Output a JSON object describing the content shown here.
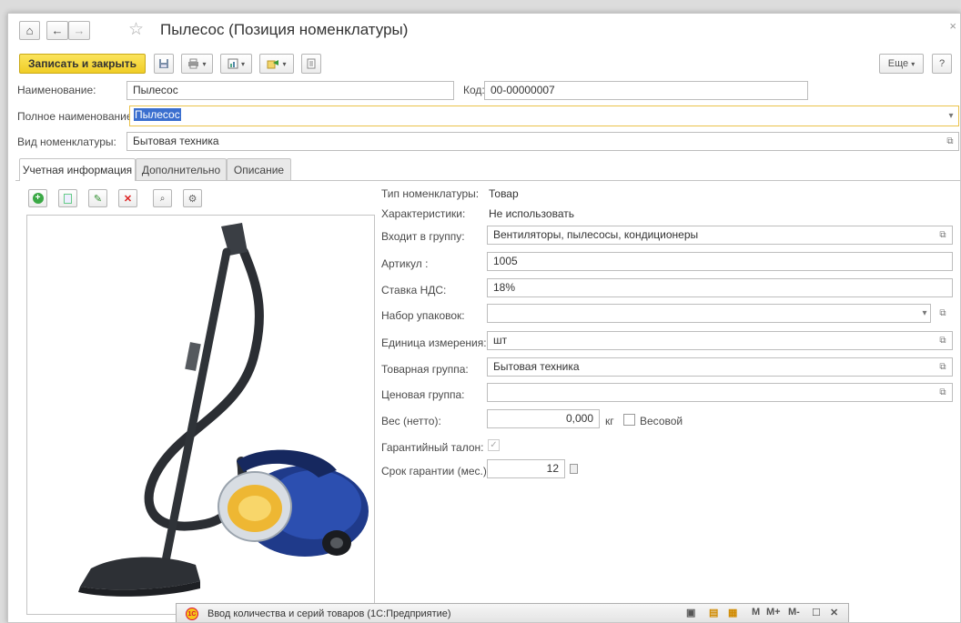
{
  "window": {
    "title": "Пылесос (Позиция номенклатуры)",
    "close": "×"
  },
  "nav": {
    "home": "⌂",
    "back": "←",
    "forward": "→",
    "favorite": "☆"
  },
  "toolbar": {
    "save_close": "Записать и закрыть",
    "more": "Еще",
    "more_arrow": "▾",
    "help": "?"
  },
  "header": {
    "name_label": "Наименование:",
    "name_value": "Пылесос",
    "code_label": "Код:",
    "code_value": "00-00000007",
    "fullname_label": "Полное наименование:",
    "fullname_value": "Пылесос",
    "kind_label": "Вид номенклатуры:",
    "kind_value": "Бытовая техника"
  },
  "tabs": [
    {
      "label": "Учетная информация"
    },
    {
      "label": "Дополнительно"
    },
    {
      "label": "Описание"
    }
  ],
  "details": {
    "type_label": "Тип номенклатуры:",
    "type_value": "Товар",
    "char_label": "Характеристики:",
    "char_value": "Не использовать",
    "group_label": "Входит в группу:",
    "group_value": "Вентиляторы, пылесосы, кондиционеры",
    "article_label": "Артикул :",
    "article_value": "1005",
    "vat_label": "Ставка НДС:",
    "vat_value": "18%",
    "pack_label": "Набор упаковок:",
    "pack_value": "",
    "unit_label": "Единица измерения:",
    "unit_value": "шт",
    "goods_group_label": "Товарная группа:",
    "goods_group_value": "Бытовая техника",
    "price_group_label": "Ценовая группа:",
    "price_group_value": "",
    "weight_label": "Вес (нетто):",
    "weight_value": "0,000",
    "weight_unit": "кг",
    "weighted_label": "Весовой",
    "warranty_label": "Гарантийный талон:",
    "warranty_period_label": "Срок гарантии (мес.):",
    "warranty_period_value": "12"
  },
  "subwindow": {
    "title": "Ввод количества и серий товаров  (1С:Предприятие)",
    "logo": "1С",
    "m": "M",
    "mplus": "M+",
    "mminus": "M-",
    "close": "✕"
  },
  "colors": {
    "accent": "#f0cd26",
    "highlight": "#eac24a",
    "selection": "#3b6fcf"
  }
}
